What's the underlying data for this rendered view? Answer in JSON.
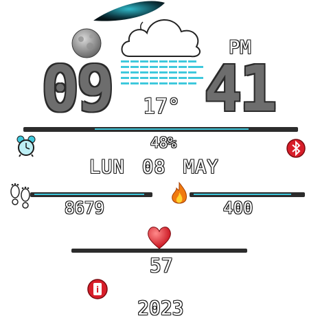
{
  "weather": {
    "icon": "cloud-icon",
    "temperature": "17°"
  },
  "time": {
    "hours": "09",
    "minutes": "41",
    "ampm": "PM"
  },
  "battery": {
    "percent_label": "48%",
    "level": 0.48
  },
  "date": {
    "day": "LUN",
    "date": "08",
    "month": "MAY",
    "year": "2023"
  },
  "steps": {
    "value": "8679",
    "icon": "footprints-icon",
    "progress": 0.9
  },
  "calories": {
    "value": "400",
    "icon": "flame-icon",
    "progress": 0.85
  },
  "heart_rate": {
    "value": "57",
    "icon": "heart-icon"
  },
  "icons": {
    "moon": "moon-icon",
    "alarm": "alarm-clock-icon",
    "bluetooth": "bluetooth-icon",
    "status": "info-icon"
  },
  "colors": {
    "accent": "#3ec8dc",
    "digits": "#6d6d6d",
    "bar": "#2c2c2c",
    "red": "#d81e2a"
  }
}
